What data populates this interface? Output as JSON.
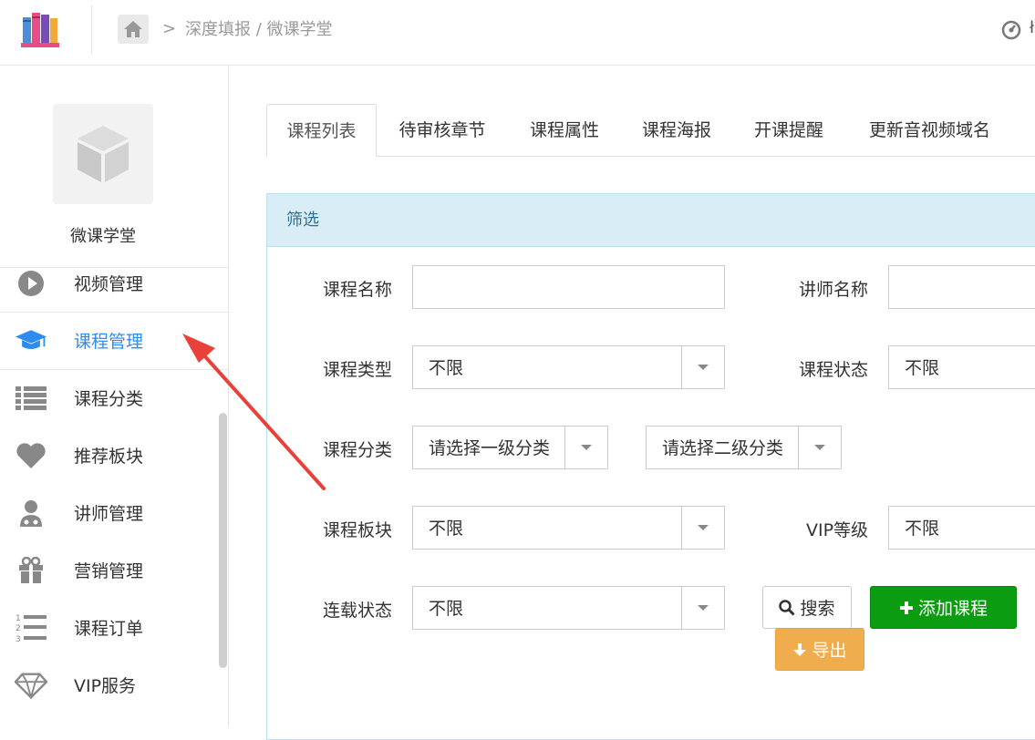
{
  "header": {
    "breadcrumb_sep": ">",
    "breadcrumb": "深度填报 / 微课学堂",
    "right_text": "ł"
  },
  "sidebar": {
    "app_name": "微课学堂",
    "items": [
      {
        "label": "视频管理",
        "icon": "play-circle-icon"
      },
      {
        "label": "课程管理",
        "icon": "graduation-cap-icon",
        "active": true
      },
      {
        "label": "课程分类",
        "icon": "list-icon"
      },
      {
        "label": "推荐板块",
        "icon": "heart-icon"
      },
      {
        "label": "讲师管理",
        "icon": "user-md-icon"
      },
      {
        "label": "营销管理",
        "icon": "gift-icon"
      },
      {
        "label": "课程订单",
        "icon": "list-ol-icon"
      },
      {
        "label": "VIP服务",
        "icon": "diamond-icon"
      }
    ],
    "active_color": "#2d8cf0"
  },
  "tabs": [
    "课程列表",
    "待审核章节",
    "课程属性",
    "课程海报",
    "开课提醒",
    "更新音视频域名"
  ],
  "filter": {
    "title": "筛选",
    "course_name_label": "课程名称",
    "course_name_value": "",
    "teacher_name_label": "讲师名称",
    "teacher_name_value": "",
    "course_type_label": "课程类型",
    "course_type_value": "不限",
    "course_status_label": "课程状态",
    "course_status_value": "不限",
    "category_label": "课程分类",
    "category1_value": "请选择一级分类",
    "category2_value": "请选择二级分类",
    "block_label": "课程板块",
    "block_value": "不限",
    "vip_label": "VIP等级",
    "vip_value": "不限",
    "serial_label": "连载状态",
    "serial_value": "不限"
  },
  "buttons": {
    "search": "搜索",
    "add": "添加课程",
    "export": "导出"
  },
  "colors": {
    "panel_head_bg": "#d9edf7",
    "add_button": "#0b9c12",
    "export_button": "#f0ad4e",
    "annotation_arrow": "#e8413a"
  }
}
